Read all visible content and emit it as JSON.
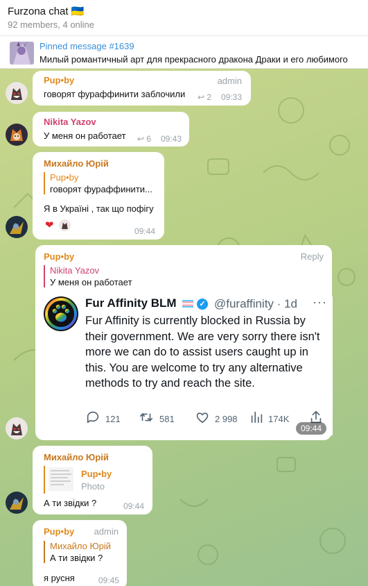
{
  "header": {
    "title": "Furzona chat 🇺🇦",
    "subtitle": "92 members, 4 online"
  },
  "pinned": {
    "title": "Pinned message #1639",
    "text": "Милый романтичный арт для прекрасного дракона Драки и его любимого"
  },
  "messages": [
    {
      "name": "Pup•by",
      "role": "admin",
      "text": "говорят фурaффинити заблочили",
      "replies": "2",
      "time": "09:33"
    },
    {
      "name": "Nikita Yazov",
      "text": "У меня он работает",
      "replies": "6",
      "time": "09:43"
    },
    {
      "name": "Михайло Юрій",
      "reply_name": "Pup•by",
      "reply_text": "говорят фурaффинити...",
      "text": "Я в Україні , так що пофігу",
      "time": "09:44"
    },
    {
      "name": "Pup•by",
      "role": "Reply",
      "reply_name": "Nikita Yazov",
      "reply_text": "У меня он работает",
      "time": "09:44",
      "tweet": {
        "name": "Fur Affinity BLM",
        "handle": "@furaffinity · 1d",
        "body": "Fur Affinity is currently blocked in Russia by their government. We are very sorry there isn't more we can do to assist users caught up in this. You are welcome to try any alternative methods to try and reach the site.",
        "replies": "121",
        "retweets": "581",
        "likes": "2 998",
        "views": "174K"
      }
    },
    {
      "name": "Михайло Юрій",
      "reply_name": "Pup•by",
      "reply_text": "Photo",
      "text": "А ти звідки ?",
      "time": "09:44"
    },
    {
      "name": "Pup•by",
      "role": "admin",
      "reply_name": "Михайло Юрій",
      "reply_text": "А ти звідки ?",
      "text": "я русня",
      "time": "09:45"
    }
  ],
  "colors": {
    "pupby": "#e08a1e",
    "nikita": "#d1426e",
    "mykhailo": "#c8771d",
    "link": "#3a8fd9"
  }
}
